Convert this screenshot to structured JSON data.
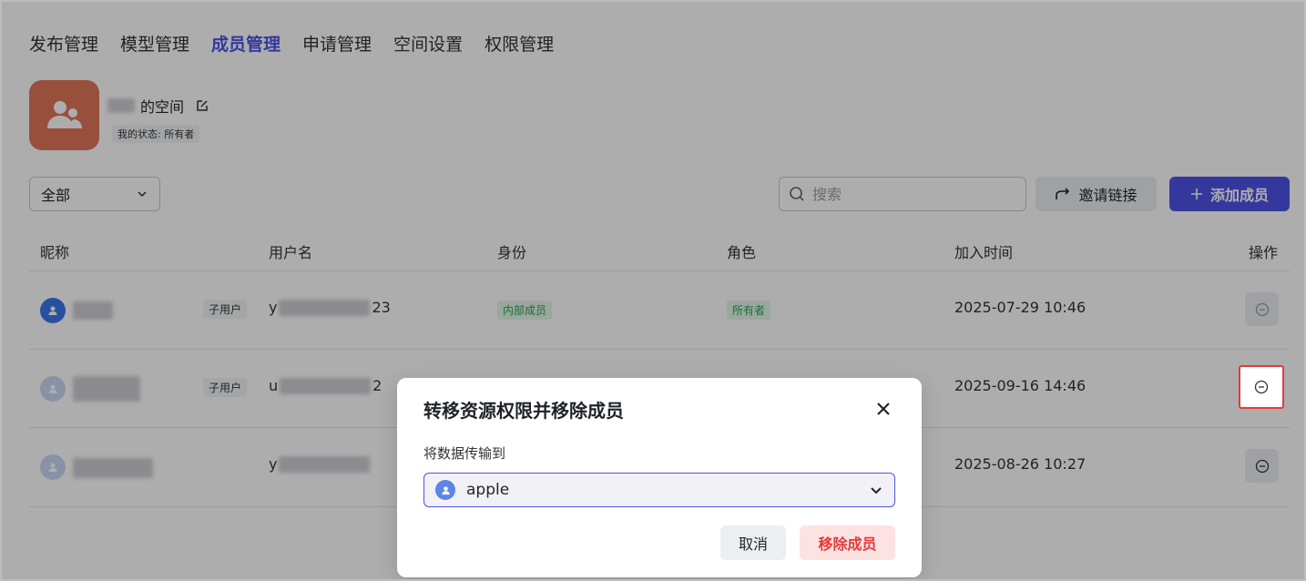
{
  "tabs": [
    {
      "label": "发布管理",
      "active": false
    },
    {
      "label": "模型管理",
      "active": false
    },
    {
      "label": "成员管理",
      "active": true
    },
    {
      "label": "申请管理",
      "active": false
    },
    {
      "label": "空间设置",
      "active": false
    },
    {
      "label": "权限管理",
      "active": false
    }
  ],
  "space": {
    "name_suffix": "的空间",
    "status": "我的状态: 所有者"
  },
  "toolbar": {
    "filter_value": "全部",
    "search_placeholder": "搜索",
    "invite_label": "邀请链接",
    "add_label": "添加成员"
  },
  "table": {
    "headers": [
      "昵称",
      "用户名",
      "身份",
      "角色",
      "加入时间",
      "操作"
    ],
    "rows": [
      {
        "sub_tag": "子用户",
        "username_prefix": "y",
        "username_suffix": "23",
        "identity": "内部成员",
        "role": "所有者",
        "joined": "2025-07-29 10:46"
      },
      {
        "sub_tag": "子用户",
        "username_prefix": "u",
        "username_suffix": "2",
        "identity": "",
        "role": "",
        "joined": "2025-09-16 14:46"
      },
      {
        "sub_tag": "",
        "username_prefix": "y",
        "username_suffix": "",
        "identity": "",
        "role": "",
        "joined": "2025-08-26 10:27"
      }
    ]
  },
  "modal": {
    "title": "转移资源权限并移除成员",
    "field_label": "将数据传输到",
    "selected_user": "apple",
    "cancel_label": "取消",
    "remove_label": "移除成员"
  },
  "colors": {
    "accent": "#4d53e8",
    "danger": "#e33b3b",
    "space_avatar": "#e0765a",
    "tag_green_bg": "#e3f6e8",
    "tag_green_text": "#2e9e55"
  }
}
